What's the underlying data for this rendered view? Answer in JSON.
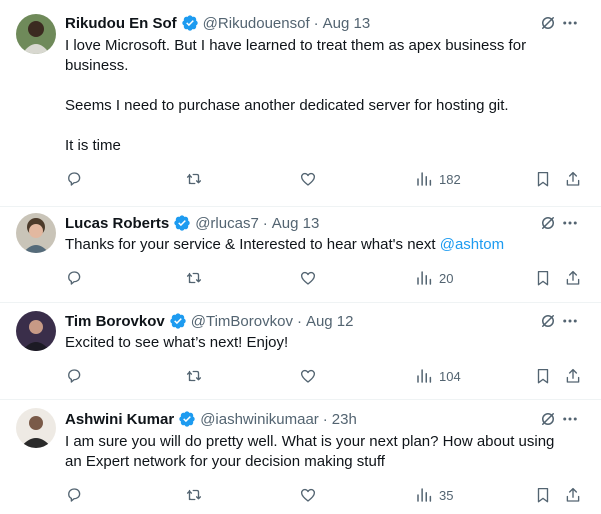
{
  "tweets": [
    {
      "name": "Rikudou En Sof",
      "handle": "@Rikudouensof",
      "dot": "·",
      "time": "Aug 13",
      "lines": [
        "I love Microsoft. But I have learned to treat them as apex business for business.",
        "",
        "Seems I need to purchase another dedicated server for hosting git.",
        "",
        "It is time"
      ],
      "mention": "",
      "views": "182"
    },
    {
      "name": "Lucas Roberts",
      "handle": "@rlucas7",
      "dot": "·",
      "time": "Aug 13",
      "lines": [
        "Thanks for your service & Interested to hear what's next "
      ],
      "mention": "@ashtom",
      "views": "20"
    },
    {
      "name": "Tim Borovkov",
      "handle": "@TimBorovkov",
      "dot": "·",
      "time": "Aug 12",
      "lines": [
        "Excited to see what’s next! Enjoy!"
      ],
      "mention": "",
      "views": "104"
    },
    {
      "name": "Ashwini Kumar",
      "handle": "@iashwinikumaar",
      "dot": "·",
      "time": "23h",
      "lines": [
        "I am sure you will do pretty well. What is your next plan? How about using an Expert network for your decision making stuff"
      ],
      "mention": "",
      "views": "35"
    }
  ],
  "icons": {
    "verified": "verified-badge-icon",
    "grok": "grok-icon",
    "more": "more-icon",
    "reply": "reply-icon",
    "retweet": "retweet-icon",
    "like": "like-icon",
    "views": "views-icon",
    "bookmark": "bookmark-icon",
    "share": "share-icon"
  },
  "colors": {
    "text": "#0f1419",
    "secondary": "#536471",
    "accent": "#1d9bf0",
    "divider": "#eff3f4"
  }
}
